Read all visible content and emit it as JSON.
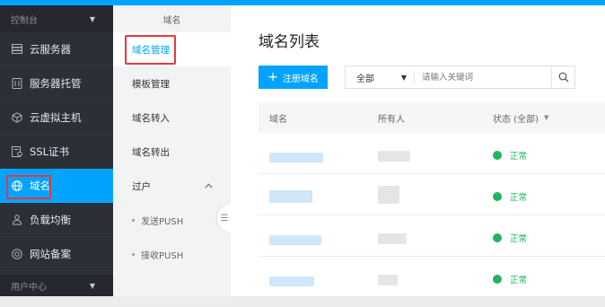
{
  "sidebar": {
    "console_label": "控制台",
    "items": [
      {
        "label": "云服务器",
        "icon": "server-icon"
      },
      {
        "label": "服务器托管",
        "icon": "hosting-icon"
      },
      {
        "label": "云虚拟主机",
        "icon": "cube-icon"
      },
      {
        "label": "SSL证书",
        "icon": "certificate-icon"
      },
      {
        "label": "域名",
        "icon": "globe-icon"
      },
      {
        "label": "负载均衡",
        "icon": "load-balance-icon"
      },
      {
        "label": "网站备案",
        "icon": "record-icon"
      }
    ],
    "user_center_label": "用户中心"
  },
  "subnav": {
    "title": "域名",
    "items": [
      "域名管理",
      "模板管理",
      "域名转入",
      "域名转出"
    ],
    "group_label": "过户",
    "sub_items": [
      "发送PUSH",
      "接收PUSH"
    ]
  },
  "main": {
    "title": "域名列表",
    "register_button": "注册域名",
    "filter_select": "全部",
    "search_placeholder": "请输入关键词",
    "columns": {
      "domain": "域名",
      "owner": "所有人",
      "status": "状态 (全部)"
    },
    "rows": [
      {
        "status": "正常"
      },
      {
        "status": "正常"
      },
      {
        "status": "正常"
      },
      {
        "status": "正常"
      }
    ]
  },
  "colors": {
    "accent": "#00a4ff",
    "sidebar": "#2b2f36",
    "highlight_box": "#e8373f",
    "status_ok": "#22b35e"
  }
}
